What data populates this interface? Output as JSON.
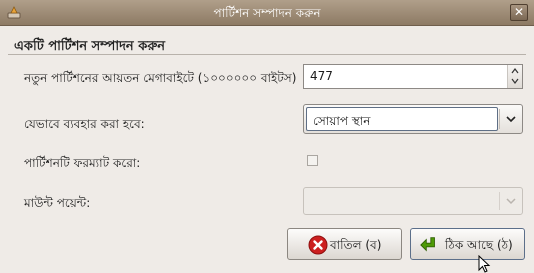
{
  "window": {
    "title": "পার্টিশন সম্পাদন করুন",
    "close_glyph": "✕"
  },
  "section": {
    "heading": "একটি পার্টিশন সম্পাদন করুন"
  },
  "form": {
    "size_label": "নতুন পার্টিশনের আয়তন মেগাবাইটে (১০০০০০০ বাইটস)",
    "size_value": "477",
    "usage_label": "যেভাবে ব্যবহার করা হবে:",
    "usage_selected": "সোয়াপ স্থান",
    "format_label": "পার্টিশনটি ফরম্যাট করো:",
    "format_checked": false,
    "mount_label": "মাউন্ট পয়েন্ট:",
    "mount_value": ""
  },
  "buttons": {
    "cancel_label": "বাতিল (ব)",
    "ok_label": "ঠিক আছে (ঠ)"
  },
  "colors": {
    "titlebar": "#9c8a74",
    "cancel_icon": "#cc1f1f",
    "ok_icon": "#4e9a06"
  },
  "icons": {
    "app": "app-icon",
    "close": "close-icon",
    "spin_up": "arrow-up-icon",
    "spin_down": "arrow-down-icon",
    "combo": "chevron-down-icon",
    "cancel": "cancel-icon",
    "ok": "ok-arrow-icon",
    "cursor": "mouse-cursor-icon"
  }
}
